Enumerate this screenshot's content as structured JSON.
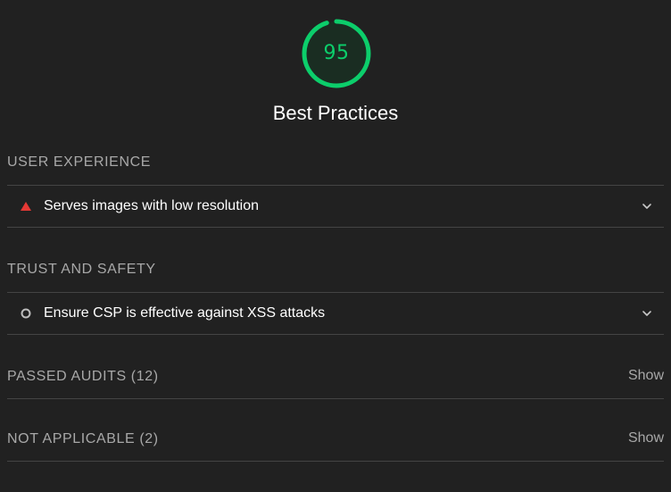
{
  "category": {
    "score": "95",
    "score_fraction": 0.95,
    "title": "Best Practices",
    "score_color": "#0cce6b"
  },
  "groups": [
    {
      "header": "USER EXPERIENCE",
      "audit": {
        "title": "Serves images with low resolution",
        "status_icon": "warning-triangle-icon",
        "status_color": "#e53935"
      }
    },
    {
      "header": "TRUST AND SAFETY",
      "audit": {
        "title": "Ensure CSP is effective against XSS attacks",
        "status_icon": "informative-circle-icon",
        "status_color": "#bdbdbd"
      }
    }
  ],
  "clumps": [
    {
      "title": "PASSED AUDITS (12)",
      "toggle": "Show"
    },
    {
      "title": "NOT APPLICABLE (2)",
      "toggle": "Show"
    }
  ]
}
